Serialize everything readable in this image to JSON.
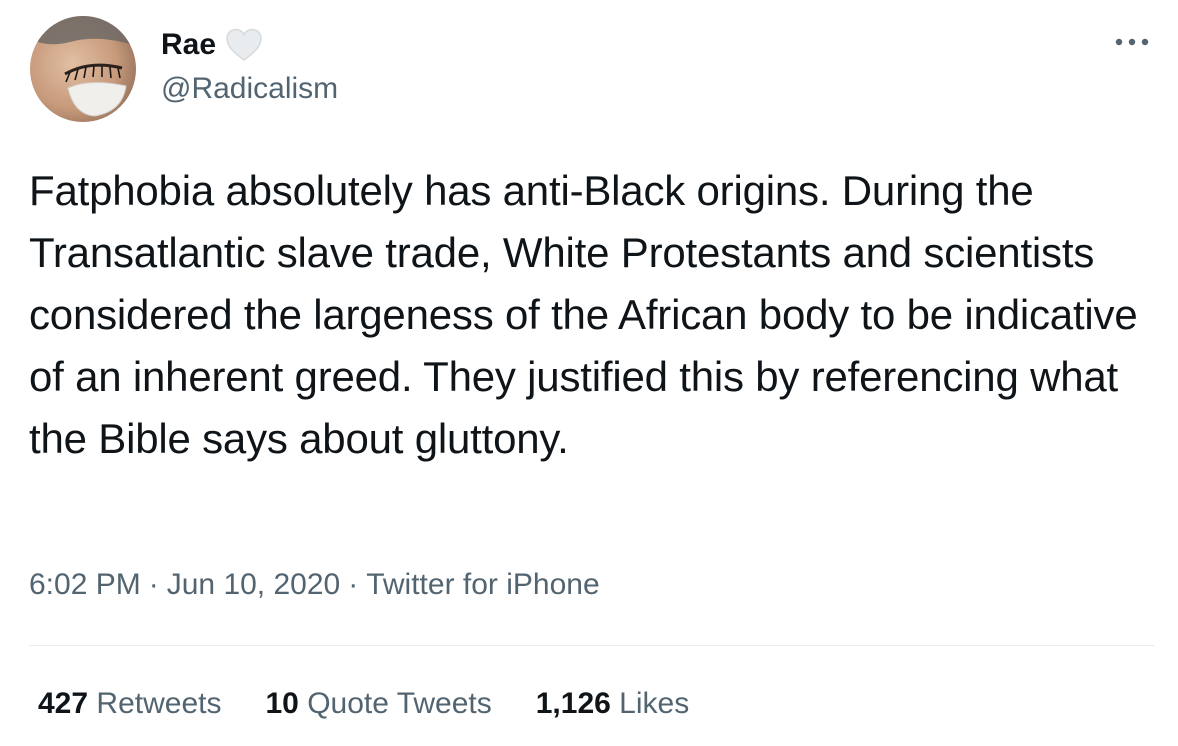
{
  "author": {
    "display_name": "Rae",
    "handle": "@Radicalism",
    "heart_icon": "heart-outline-icon",
    "avatar_icon": "profile-avatar"
  },
  "more_icon": "more-horizontal-icon",
  "tweet": {
    "text": "Fatphobia absolutely has anti-Black origins. During the Transatlantic slave trade, White Protestants and scientists considered the largeness of the African body to be indicative of an inherent greed. They justified this by referencing what the Bible says about gluttony.",
    "time": "6:02 PM",
    "date": "Jun 10, 2020",
    "source": "Twitter for iPhone",
    "separator": "·"
  },
  "stats": {
    "retweets": {
      "count": "427",
      "label": "Retweets"
    },
    "quote_tweets": {
      "count": "10",
      "label": "Quote Tweets"
    },
    "likes": {
      "count": "1,126",
      "label": "Likes"
    }
  },
  "colors": {
    "text": "#0f1419",
    "secondary": "#536471",
    "divider": "#e6ecf0",
    "heart": "#d9dde0"
  }
}
